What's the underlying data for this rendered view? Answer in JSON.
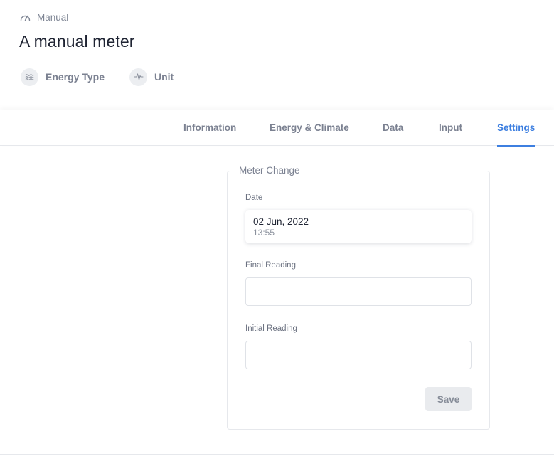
{
  "breadcrumb": {
    "icon": "gauge-icon",
    "label": "Manual"
  },
  "page": {
    "title": "A manual meter"
  },
  "meta": [
    {
      "icon": "wave-lines-icon",
      "label": "Energy Type"
    },
    {
      "icon": "pulse-icon",
      "label": "Unit"
    }
  ],
  "tabs": [
    {
      "label": "Information",
      "active": false
    },
    {
      "label": "Energy & Climate",
      "active": false
    },
    {
      "label": "Data",
      "active": false
    },
    {
      "label": "Input",
      "active": false
    },
    {
      "label": "Settings",
      "active": true
    }
  ],
  "meter_change": {
    "legend": "Meter Change",
    "date_label": "Date",
    "date_value": "02 Jun, 2022",
    "time_value": "13:55",
    "final_reading_label": "Final Reading",
    "final_reading_value": "",
    "initial_reading_label": "Initial Reading",
    "initial_reading_value": "",
    "save_label": "Save"
  },
  "colors": {
    "accent": "#3d7fe0",
    "muted_text": "#7b8191",
    "title_text": "#1f2433"
  }
}
